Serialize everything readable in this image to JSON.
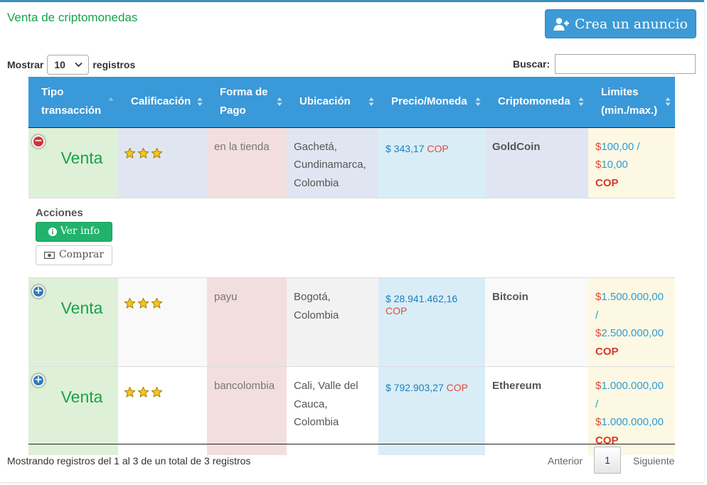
{
  "panel": {
    "title": "Venta de criptomonedas",
    "create_button": "Crea un anuncio"
  },
  "length_menu": {
    "prefix": "Mostrar",
    "value": "10",
    "suffix": "registros"
  },
  "search": {
    "label": "Buscar:",
    "value": ""
  },
  "columns": [
    "Tipo transacción",
    "Calificación",
    "Forma de Pago",
    "Ubicación",
    "Precio/Moneda",
    "Criptomoneda",
    "Limites (min./max.)"
  ],
  "rows": [
    {
      "type": "Venta",
      "stars": 3,
      "payment": "en la tienda",
      "location": "Gachetá, Cundinamarca, Colombia",
      "price": "$ 343,17",
      "price_currency": "COP",
      "coin": "GoldCoin",
      "limit_min": "100,00 /",
      "limit_max": "10,00",
      "limit_currency": "COP",
      "expanded": true
    },
    {
      "type": "Venta",
      "stars": 3,
      "payment": "payu",
      "location": "Bogotá, Colombia",
      "price": "$ 28.941.462,16",
      "price_currency": "COP",
      "coin": "Bitcoin",
      "limit_min": "1.500.000,00",
      "limit_sep": "/",
      "limit_max": "2.500.000,00",
      "limit_currency": "COP",
      "expanded": false
    },
    {
      "type": "Venta",
      "stars": 3,
      "payment": "bancolombia",
      "location": "Cali, Valle del Cauca, Colombia",
      "price": "$ 792.903,27",
      "price_currency": "COP",
      "coin": "Ethereum",
      "limit_min": "1.000.000,00",
      "limit_sep": "/",
      "limit_max": "1.000.000,00",
      "limit_currency": "COP",
      "expanded": false
    }
  ],
  "child_row": {
    "title": "Acciones",
    "info_button": "Ver info",
    "buy_button": "Comprar"
  },
  "footer": {
    "info": "Mostrando registros del 1 al 3 de un total de 3 registros",
    "prev": "Anterior",
    "page": "1",
    "next": "Siguiente"
  },
  "colors": {
    "header_bg": "#3a99d8",
    "accent_green": "#18a24a",
    "info_button": "#21b36b",
    "currency_red": "#e04b3a"
  },
  "icons": {
    "create": "user-plus-icon",
    "info": "info-circle-icon",
    "buy": "money-bill-icon",
    "rating": "star-icon",
    "sort": "sort-icon",
    "collapse": "minus-circle-icon",
    "expand": "plus-circle-icon"
  }
}
